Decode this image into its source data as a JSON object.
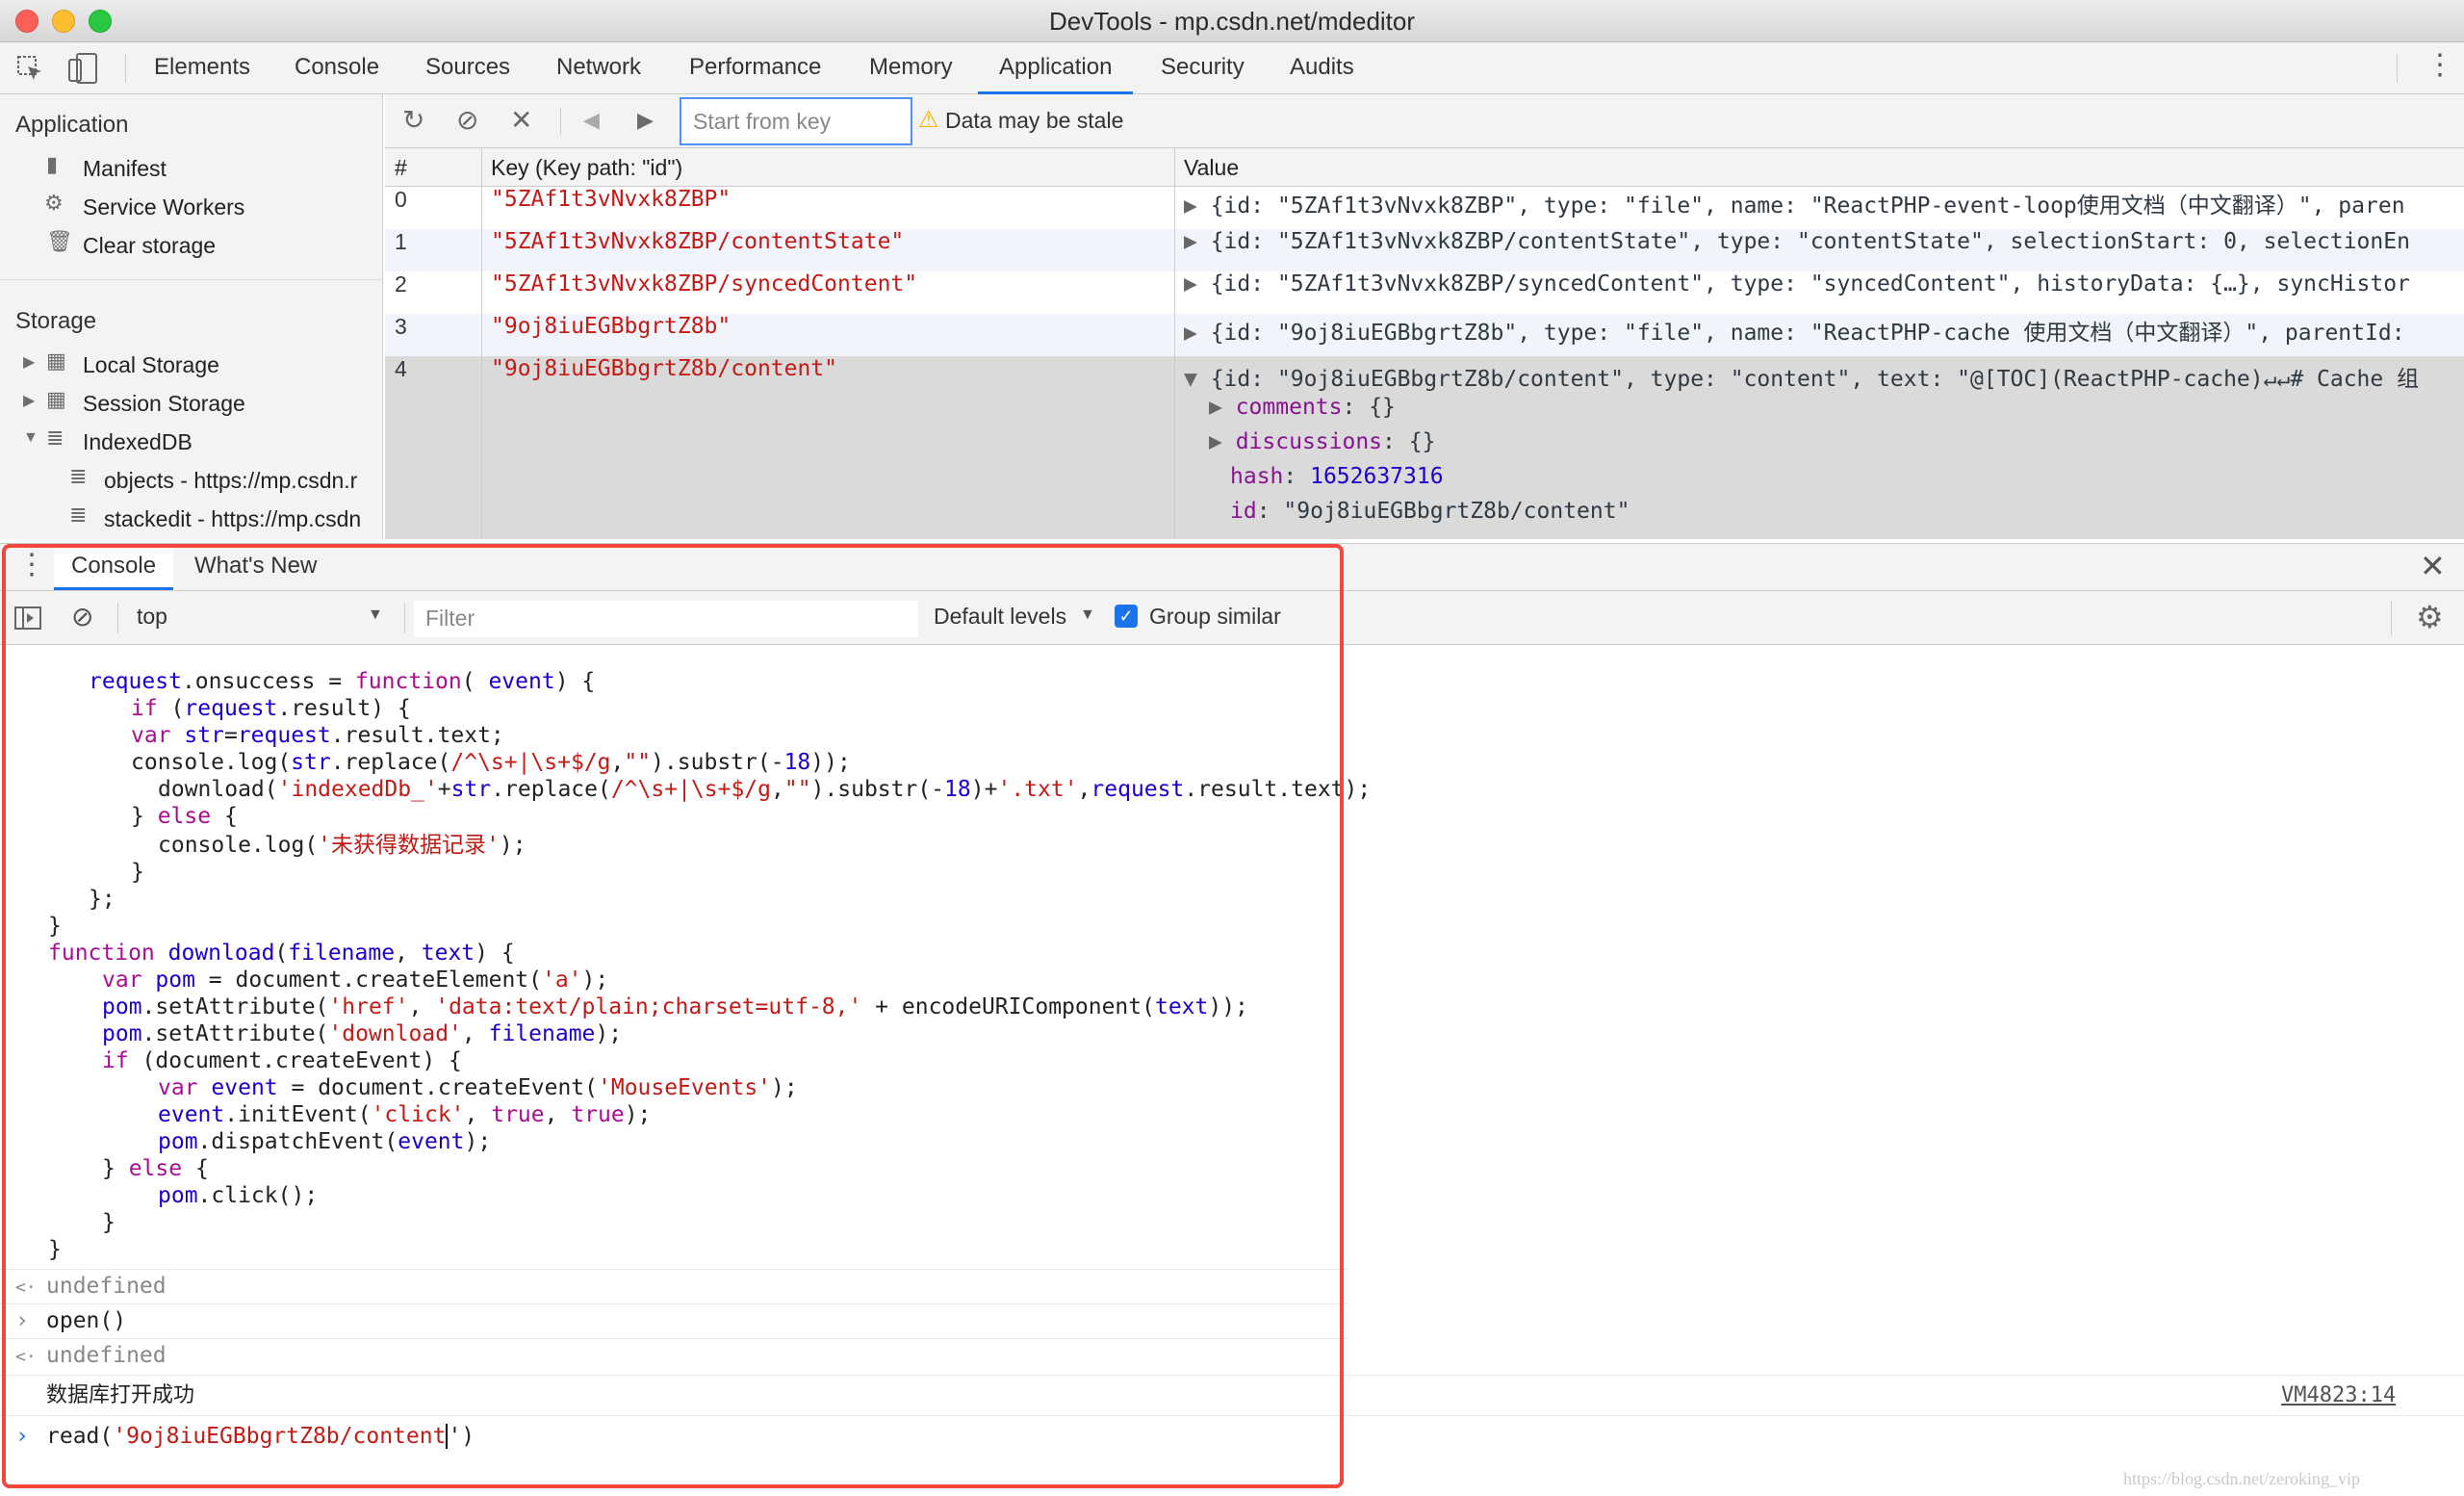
{
  "window": {
    "title": "DevTools - mp.csdn.net/mdeditor"
  },
  "tabs": [
    "Elements",
    "Console",
    "Sources",
    "Network",
    "Performance",
    "Memory",
    "Application",
    "Security",
    "Audits"
  ],
  "sidebar": {
    "application_header": "Application",
    "application_items": [
      "Manifest",
      "Service Workers",
      "Clear storage"
    ],
    "storage_header": "Storage",
    "storage_items": [
      "Local Storage",
      "Session Storage",
      "IndexedDB"
    ],
    "indexeddb_items": [
      "objects - https://mp.csdn.r",
      "stackedit - https://mp.csdn"
    ]
  },
  "db_toolbar": {
    "key_placeholder": "Start from key",
    "stale_warning": "Data may be stale"
  },
  "grid": {
    "headers": [
      "#",
      "Key (Key path: \"id\")",
      "Value"
    ],
    "rows": [
      {
        "idx": "0",
        "key": "\"5ZAf1t3vNvxk8ZBP\"",
        "value": "{id: \"5ZAf1t3vNvxk8ZBP\", type: \"file\", name: \"ReactPHP-event-loop使用文档（中文翻译）\", paren"
      },
      {
        "idx": "1",
        "key": "\"5ZAf1t3vNvxk8ZBP/contentState\"",
        "value": "{id: \"5ZAf1t3vNvxk8ZBP/contentState\", type: \"contentState\", selectionStart: 0, selectionEn"
      },
      {
        "idx": "2",
        "key": "\"5ZAf1t3vNvxk8ZBP/syncedContent\"",
        "value": "{id: \"5ZAf1t3vNvxk8ZBP/syncedContent\", type: \"syncedContent\", historyData: {…}, syncHistor"
      },
      {
        "idx": "3",
        "key": "\"9oj8iuEGBbgrtZ8b\"",
        "value": "{id: \"9oj8iuEGBbgrtZ8b\", type: \"file\", name: \"ReactPHP-cache 使用文档（中文翻译）\", parentId:"
      },
      {
        "idx": "4",
        "key": "\"9oj8iuEGBbgrtZ8b/content\"",
        "value": "{id: \"9oj8iuEGBbgrtZ8b/content\", type: \"content\", text: \"@[TOC](ReactPHP-cache)↵↵# Cache 组"
      }
    ],
    "expanded": [
      {
        "k": "comments",
        "v": "{}"
      },
      {
        "k": "discussions",
        "v": "{}"
      },
      {
        "k": "hash",
        "v": "1652637316"
      },
      {
        "k": "id",
        "v": "\"9oj8iuEGBbgrtZ8b/content\""
      }
    ]
  },
  "drawer": {
    "tabs": [
      "Console",
      "What's New"
    ]
  },
  "console_toolbar": {
    "context": "top",
    "filter_placeholder": "Filter",
    "levels": "Default levels",
    "group_similar": "Group similar"
  },
  "console": {
    "result1": "undefined",
    "input2": "open()",
    "result2": "undefined",
    "log_msg": "数据库打开成功",
    "log_src": "VM4823:14",
    "current_input_prefix": "read(",
    "current_input_string": "'9oj8iuEGBbgrtZ8b/content",
    "current_input_suffix": "')"
  },
  "watermark": "https://blog.csdn.net/zeroking_vip"
}
